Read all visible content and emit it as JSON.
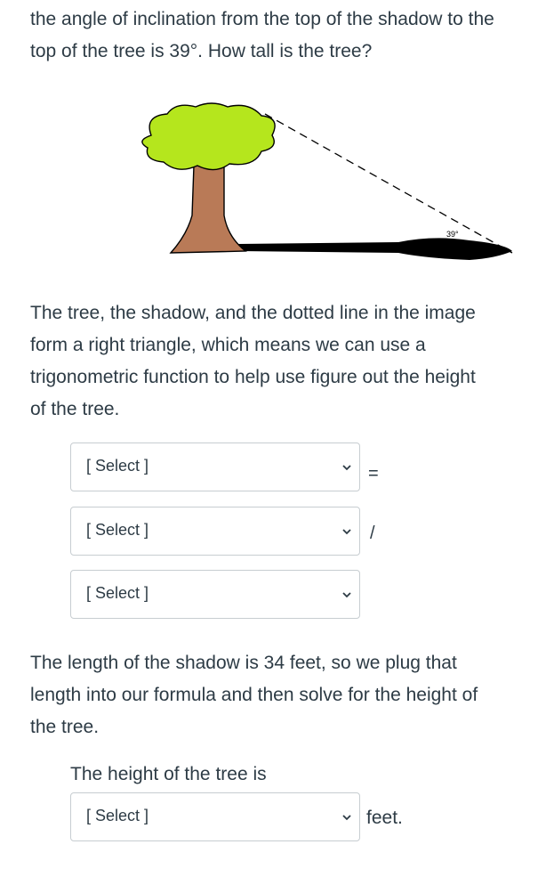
{
  "question": {
    "lines": [
      "the angle of inclination from the top of the shadow to the",
      "top of the tree is 39°. How tall is the tree?"
    ]
  },
  "figure": {
    "angle_label": "39°",
    "colors": {
      "foliage": "#b5e61d",
      "trunk": "#b97a57",
      "shadow": "#000000"
    }
  },
  "explanation": {
    "lines": [
      "The tree, the shadow, and the dotted line in the image",
      "form a right triangle, which means we can use a",
      "trigonometric function to help use figure out the height",
      "of the tree."
    ]
  },
  "formula": {
    "select_1": "[ Select ]",
    "operator_1": "=",
    "select_2": "[ Select ]",
    "operator_2": "/",
    "select_3": "[ Select ]"
  },
  "shadow_paragraph": {
    "lines": [
      "The length of the shadow is 34 feet, so we plug that",
      "length into our formula and then solve for the height of",
      "the tree."
    ]
  },
  "answer": {
    "label": "The height of the tree is",
    "select": "[ Select ]",
    "unit": "feet."
  }
}
